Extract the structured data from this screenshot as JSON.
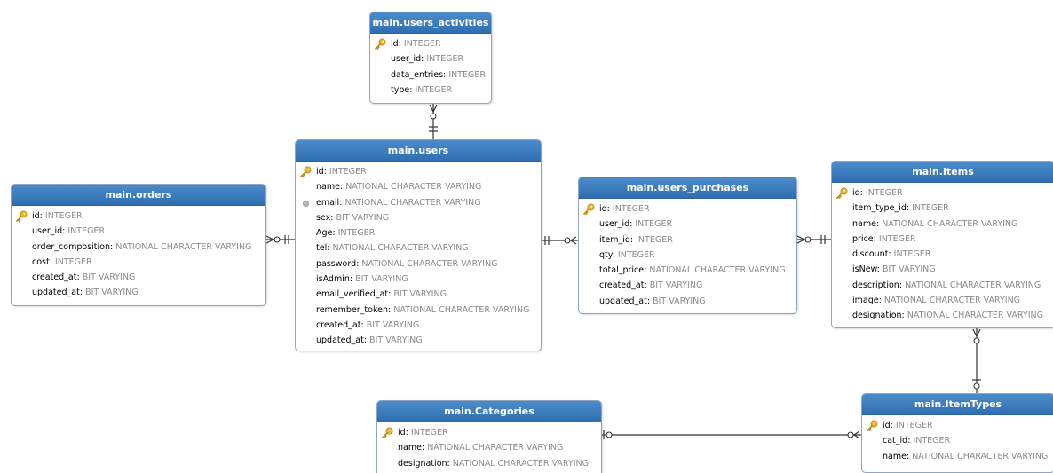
{
  "entities": {
    "users_activities": {
      "title": "main.users_activities",
      "fields": [
        {
          "name": "id",
          "type": "INTEGER",
          "icon": "key-icon"
        },
        {
          "name": "user_id",
          "type": "INTEGER"
        },
        {
          "name": "data_entries",
          "type": "INTEGER"
        },
        {
          "name": "type",
          "type": "INTEGER"
        }
      ]
    },
    "users": {
      "title": "main.users",
      "fields": [
        {
          "name": "id",
          "type": "INTEGER",
          "icon": "key-icon"
        },
        {
          "name": "name",
          "type": "NATIONAL CHARACTER VARYING"
        },
        {
          "name": "email",
          "type": "NATIONAL CHARACTER VARYING",
          "icon": "index-icon"
        },
        {
          "name": "sex",
          "type": "BIT VARYING"
        },
        {
          "name": "Age",
          "type": "INTEGER"
        },
        {
          "name": "tel",
          "type": "NATIONAL CHARACTER VARYING"
        },
        {
          "name": "password",
          "type": "NATIONAL CHARACTER VARYING"
        },
        {
          "name": "isAdmin",
          "type": "BIT VARYING"
        },
        {
          "name": "email_verified_at",
          "type": "BIT VARYING"
        },
        {
          "name": "remember_token",
          "type": "NATIONAL CHARACTER VARYING"
        },
        {
          "name": "created_at",
          "type": "BIT VARYING"
        },
        {
          "name": "updated_at",
          "type": "BIT VARYING"
        }
      ]
    },
    "orders": {
      "title": "main.orders",
      "fields": [
        {
          "name": "id",
          "type": "INTEGER",
          "icon": "key-icon"
        },
        {
          "name": "user_id",
          "type": "INTEGER"
        },
        {
          "name": "order_composition",
          "type": "NATIONAL CHARACTER VARYING"
        },
        {
          "name": "cost",
          "type": "INTEGER"
        },
        {
          "name": "created_at",
          "type": "BIT VARYING"
        },
        {
          "name": "updated_at",
          "type": "BIT VARYING"
        }
      ]
    },
    "users_purchases": {
      "title": "main.users_purchases",
      "fields": [
        {
          "name": "id",
          "type": "INTEGER",
          "icon": "key-icon"
        },
        {
          "name": "user_id",
          "type": "INTEGER"
        },
        {
          "name": "item_id",
          "type": "INTEGER"
        },
        {
          "name": "qty",
          "type": "INTEGER"
        },
        {
          "name": "total_price",
          "type": "NATIONAL CHARACTER VARYING"
        },
        {
          "name": "created_at",
          "type": "BIT VARYING"
        },
        {
          "name": "updated_at",
          "type": "BIT VARYING"
        }
      ]
    },
    "items": {
      "title": "main.Items",
      "fields": [
        {
          "name": "id",
          "type": "INTEGER",
          "icon": "key-icon"
        },
        {
          "name": "item_type_id",
          "type": "INTEGER"
        },
        {
          "name": "name",
          "type": "NATIONAL CHARACTER VARYING"
        },
        {
          "name": "price",
          "type": "INTEGER"
        },
        {
          "name": "discount",
          "type": "INTEGER"
        },
        {
          "name": "isNew",
          "type": "BIT VARYING"
        },
        {
          "name": "description",
          "type": "NATIONAL CHARACTER VARYING"
        },
        {
          "name": "image",
          "type": "NATIONAL CHARACTER VARYING"
        },
        {
          "name": "designation",
          "type": "NATIONAL CHARACTER VARYING"
        }
      ]
    },
    "categories": {
      "title": "main.Categories",
      "fields": [
        {
          "name": "id",
          "type": "INTEGER",
          "icon": "key-icon"
        },
        {
          "name": "name",
          "type": "NATIONAL CHARACTER VARYING"
        },
        {
          "name": "designation",
          "type": "NATIONAL CHARACTER VARYING"
        }
      ]
    },
    "itemtypes": {
      "title": "main.ItemTypes",
      "fields": [
        {
          "name": "id",
          "type": "INTEGER",
          "icon": "key-icon"
        },
        {
          "name": "cat_id",
          "type": "INTEGER"
        },
        {
          "name": "name",
          "type": "NATIONAL CHARACTER VARYING"
        }
      ]
    }
  },
  "colors": {
    "header_top": "#4d8ccb",
    "header_bottom": "#2f6fb0",
    "border": "#8fa6bd",
    "type_text": "#8a8a8a",
    "connector": "#333333",
    "key": "#e8b52f"
  }
}
